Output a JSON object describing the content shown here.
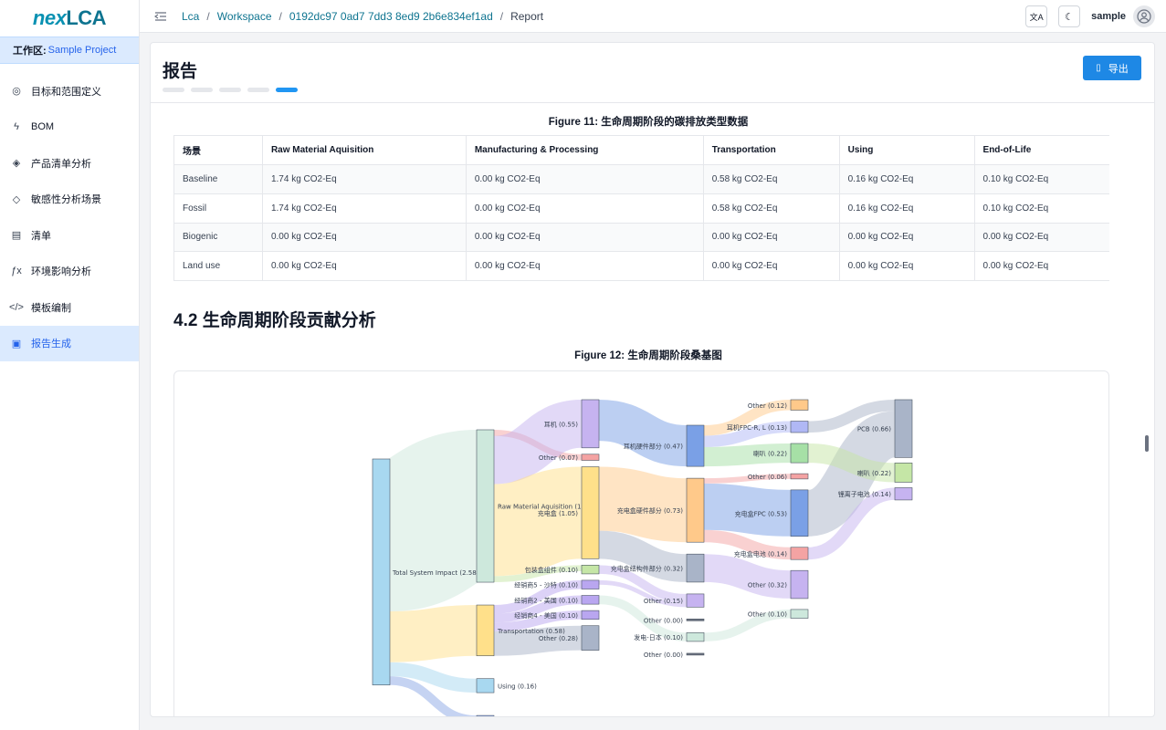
{
  "app": {
    "logo_nex": "nex",
    "logo_lca": "LCA"
  },
  "workspace": {
    "label": "工作区:",
    "name": "Sample Project"
  },
  "nav": [
    {
      "label": "目标和范围定义",
      "icon": "target-icon",
      "glyph": "◎"
    },
    {
      "label": "BOM",
      "icon": "bolt-icon",
      "glyph": "ϟ"
    },
    {
      "label": "产品清单分析",
      "icon": "layers-icon",
      "glyph": "◈"
    },
    {
      "label": "敏感性分析场景",
      "icon": "badge-icon",
      "glyph": "◇"
    },
    {
      "label": "清单",
      "icon": "receipt-icon",
      "glyph": "▤"
    },
    {
      "label": "环境影响分析",
      "icon": "function-icon",
      "glyph": "ƒx"
    },
    {
      "label": "模板编制",
      "icon": "code-icon",
      "glyph": "</>"
    },
    {
      "label": "报告生成",
      "icon": "report-icon",
      "glyph": "▣"
    }
  ],
  "breadcrumb": [
    {
      "label": "Lca"
    },
    {
      "label": "Workspace"
    },
    {
      "label": "0192dc97 0ad7 7dd3 8ed9 2b6e834ef1ad"
    },
    {
      "label": "Report"
    }
  ],
  "topbar": {
    "lang_glyph": "文A",
    "theme_glyph": "☾",
    "username": "sample"
  },
  "page": {
    "title": "报告",
    "export_label": "导出",
    "steps_total": 5,
    "steps_active": 5
  },
  "table": {
    "caption": "Figure 11: 生命周期阶段的碳排放类型数据",
    "headers": [
      "场景",
      "Raw Material Aquisition",
      "Manufacturing & Processing",
      "Transportation",
      "Using",
      "End-of-Life"
    ],
    "rows": [
      [
        "Baseline",
        "1.74 kg CO2-Eq",
        "0.00 kg CO2-Eq",
        "0.58 kg CO2-Eq",
        "0.16 kg CO2-Eq",
        "0.10 kg CO2-Eq"
      ],
      [
        "Fossil",
        "1.74 kg CO2-Eq",
        "0.00 kg CO2-Eq",
        "0.58 kg CO2-Eq",
        "0.16 kg CO2-Eq",
        "0.10 kg CO2-Eq"
      ],
      [
        "Biogenic",
        "0.00 kg CO2-Eq",
        "0.00 kg CO2-Eq",
        "0.00 kg CO2-Eq",
        "0.00 kg CO2-Eq",
        "0.00 kg CO2-Eq"
      ],
      [
        "Land use",
        "0.00 kg CO2-Eq",
        "0.00 kg CO2-Eq",
        "0.00 kg CO2-Eq",
        "0.00 kg CO2-Eq",
        "0.00 kg CO2-Eq"
      ]
    ]
  },
  "section": {
    "title": "4.2 生命周期阶段贡献分析",
    "caption": "Figure 12: 生命周期阶段桑基图"
  },
  "chart_data": {
    "type": "sankey",
    "nodes": [
      {
        "id": "total",
        "label": "Total System Impact (2.58)",
        "value": 2.58,
        "color": "#a8d8f0",
        "col": 0
      },
      {
        "id": "raw",
        "label": "Raw Material Aquisition (1.74)",
        "value": 1.74,
        "color": "#cde8dc",
        "col": 1
      },
      {
        "id": "transport",
        "label": "Transportation (0.58)",
        "value": 0.58,
        "color": "#ffe08a",
        "col": 1
      },
      {
        "id": "using",
        "label": "Using (0.16)",
        "value": 0.16,
        "color": "#a8d8f0",
        "col": 1
      },
      {
        "id": "other_c1",
        "label": "Other (0.10)",
        "value": 0.1,
        "color": "#8ba7e6",
        "col": 1
      },
      {
        "id": "earphone",
        "label": "耳机 (0.55)",
        "value": 0.55,
        "color": "#c6b3f0",
        "col": 2
      },
      {
        "id": "other_a",
        "label": "Other (0.07)",
        "value": 0.07,
        "color": "#f4a3a3",
        "col": 2
      },
      {
        "id": "case",
        "label": "充电盒 (1.05)",
        "value": 1.05,
        "color": "#ffe08a",
        "col": 2
      },
      {
        "id": "pack",
        "label": "包装盒组件 (0.10)",
        "value": 0.1,
        "color": "#c5e6a6",
        "col": 2
      },
      {
        "id": "dist5",
        "label": "经销商5 - 沙特 (0.10)",
        "value": 0.1,
        "color": "#b9a6f0",
        "col": 2
      },
      {
        "id": "dist2",
        "label": "经销商2 - 美国 (0.10)",
        "value": 0.1,
        "color": "#b9a6f0",
        "col": 2
      },
      {
        "id": "dist4",
        "label": "经销商4 - 美国 (0.10)",
        "value": 0.1,
        "color": "#b9a6f0",
        "col": 2
      },
      {
        "id": "other_t",
        "label": "Other (0.28)",
        "value": 0.28,
        "color": "#a9b4c8",
        "col": 2
      },
      {
        "id": "ear_hw",
        "label": "耳机硬件部分 (0.47)",
        "value": 0.47,
        "color": "#7aa0e6",
        "col": 3
      },
      {
        "id": "case_hw",
        "label": "充电盒硬件部分 (0.73)",
        "value": 0.73,
        "color": "#ffc98a",
        "col": 3
      },
      {
        "id": "case_struct",
        "label": "充电盒结构件部分 (0.32)",
        "value": 0.32,
        "color": "#a9b4c8",
        "col": 3
      },
      {
        "id": "other_b",
        "label": "Other (0.15)",
        "value": 0.15,
        "color": "#c6b3f0",
        "col": 3
      },
      {
        "id": "other_z1",
        "label": "Other (0.00)",
        "value": 0.0,
        "color": "#6b7280",
        "col": 3
      },
      {
        "id": "ship",
        "label": "发电-日本 (0.10)",
        "value": 0.1,
        "color": "#cde8dc",
        "col": 3
      },
      {
        "id": "other_z2",
        "label": "Other (0.00)",
        "value": 0.0,
        "color": "#6b7280",
        "col": 3
      },
      {
        "id": "other_c",
        "label": "Other (0.12)",
        "value": 0.12,
        "color": "#ffc98a",
        "col": 4
      },
      {
        "id": "fpc_ear",
        "label": "耳机FPC-R, L (0.13)",
        "value": 0.13,
        "color": "#b0b8f5",
        "col": 4
      },
      {
        "id": "speaker",
        "label": "喇叭 (0.22)",
        "value": 0.22,
        "color": "#a6e0a6",
        "col": 4
      },
      {
        "id": "other_d",
        "label": "Other (0.06)",
        "value": 0.06,
        "color": "#f4a3a3",
        "col": 4
      },
      {
        "id": "fpc_case",
        "label": "充电盒FPC (0.53)",
        "value": 0.53,
        "color": "#7aa0e6",
        "col": 4
      },
      {
        "id": "battery",
        "label": "充电盒电池 (0.14)",
        "value": 0.14,
        "color": "#f4a3a3",
        "col": 4
      },
      {
        "id": "other_e",
        "label": "Other (0.32)",
        "value": 0.32,
        "color": "#c6b3f0",
        "col": 4
      },
      {
        "id": "other_f",
        "label": "Other (0.10)",
        "value": 0.1,
        "color": "#cde8dc",
        "col": 4
      },
      {
        "id": "pcb",
        "label": "PCB (0.66)",
        "value": 0.66,
        "color": "#a9b4c8",
        "col": 5
      },
      {
        "id": "speaker2",
        "label": "喇叭 (0.22)",
        "value": 0.22,
        "color": "#c5e6a6",
        "col": 5
      },
      {
        "id": "li_battery",
        "label": "锂离子电池 (0.14)",
        "value": 0.14,
        "color": "#c6b3f0",
        "col": 5
      }
    ],
    "links": [
      {
        "source": "total",
        "target": "raw",
        "value": 1.74
      },
      {
        "source": "total",
        "target": "transport",
        "value": 0.58
      },
      {
        "source": "total",
        "target": "using",
        "value": 0.16
      },
      {
        "source": "total",
        "target": "other_c1",
        "value": 0.1
      },
      {
        "source": "raw",
        "target": "other_a",
        "value": 0.07
      },
      {
        "source": "raw",
        "target": "earphone",
        "value": 0.55
      },
      {
        "source": "raw",
        "target": "case",
        "value": 1.05
      },
      {
        "source": "raw",
        "target": "pack",
        "value": 0.07
      },
      {
        "source": "transport",
        "target": "dist5",
        "value": 0.1
      },
      {
        "source": "transport",
        "target": "dist2",
        "value": 0.1
      },
      {
        "source": "transport",
        "target": "dist4",
        "value": 0.1
      },
      {
        "source": "transport",
        "target": "other_t",
        "value": 0.28
      },
      {
        "source": "earphone",
        "target": "ear_hw",
        "value": 0.47
      },
      {
        "source": "case",
        "target": "case_hw",
        "value": 0.73
      },
      {
        "source": "case",
        "target": "case_struct",
        "value": 0.32
      },
      {
        "source": "pack",
        "target": "other_b",
        "value": 0.1
      },
      {
        "source": "dist5",
        "target": "other_b",
        "value": 0.05
      },
      {
        "source": "dist2",
        "target": "ship",
        "value": 0.1
      },
      {
        "source": "ear_hw",
        "target": "other_c",
        "value": 0.12
      },
      {
        "source": "ear_hw",
        "target": "fpc_ear",
        "value": 0.13
      },
      {
        "source": "ear_hw",
        "target": "speaker",
        "value": 0.22
      },
      {
        "source": "case_hw",
        "target": "other_d",
        "value": 0.06
      },
      {
        "source": "case_hw",
        "target": "fpc_case",
        "value": 0.53
      },
      {
        "source": "case_hw",
        "target": "battery",
        "value": 0.14
      },
      {
        "source": "case_struct",
        "target": "other_e",
        "value": 0.32
      },
      {
        "source": "ship",
        "target": "other_f",
        "value": 0.1
      },
      {
        "source": "fpc_ear",
        "target": "pcb",
        "value": 0.13
      },
      {
        "source": "fpc_case",
        "target": "pcb",
        "value": 0.53
      },
      {
        "source": "speaker",
        "target": "speaker2",
        "value": 0.22
      },
      {
        "source": "battery",
        "target": "li_battery",
        "value": 0.14
      }
    ]
  }
}
